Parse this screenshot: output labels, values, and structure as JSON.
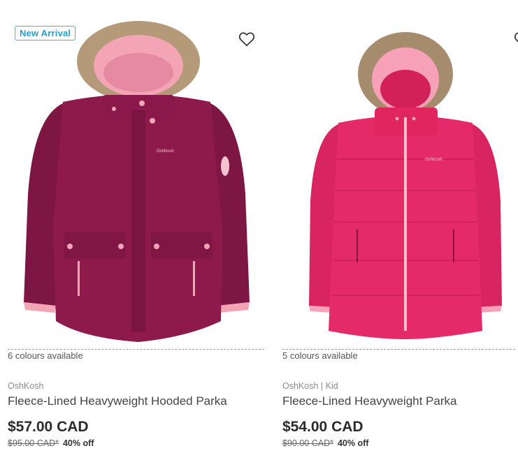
{
  "products": [
    {
      "badge": "New Arrival",
      "colours": "6 colours available",
      "brand": "OshKosh",
      "title": "Fleece-Lined Heavyweight Hooded Parka",
      "price": "$57.00 CAD",
      "was_price": "$95.00 CAD*",
      "discount": "40% off",
      "image_label": "OshKosh",
      "colors": {
        "jacket": "#8e1a4c",
        "lining": "#f3a5b6",
        "fur": "#b49a78"
      }
    },
    {
      "badge": "",
      "colours": "5 colours available",
      "brand": "OshKosh | Kid",
      "title": "Fleece-Lined Heavyweight Parka",
      "price": "$54.00 CAD",
      "was_price": "$90.00 CAD*",
      "discount": "40% off",
      "image_label": "OshKosh",
      "colors": {
        "jacket": "#e52a69",
        "lining": "#f7a1b8",
        "fur": "#a58c6d"
      }
    }
  ],
  "icons": {
    "favorite": "heart-outline-icon"
  },
  "accent": "#38b6e6"
}
